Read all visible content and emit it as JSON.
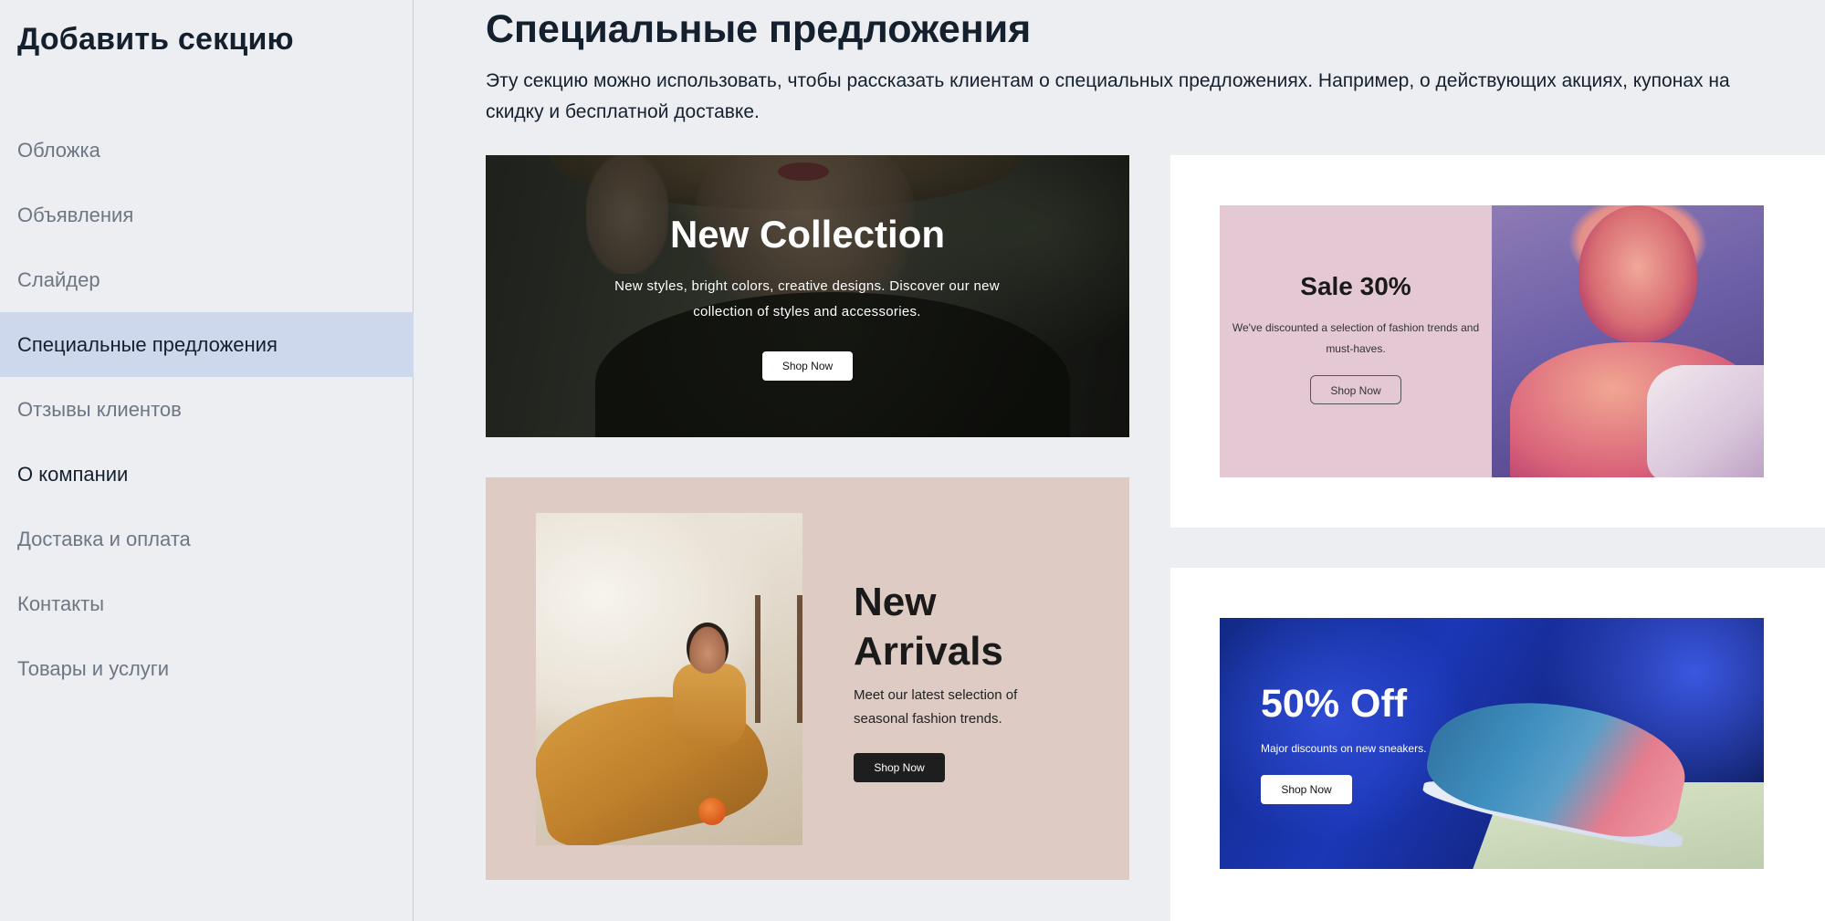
{
  "sidebar": {
    "title": "Добавить секцию",
    "items": [
      {
        "label": "Обложка"
      },
      {
        "label": "Объявления"
      },
      {
        "label": "Слайдер"
      },
      {
        "label": "Специальные предложения"
      },
      {
        "label": "Отзывы клиентов"
      },
      {
        "label": "О компании"
      },
      {
        "label": "Доставка и оплата"
      },
      {
        "label": "Контакты"
      },
      {
        "label": "Товары и услуги"
      }
    ],
    "active_index": 3
  },
  "main": {
    "title": "Специальные предложения",
    "description": "Эту секцию можно использовать, чтобы рассказать клиентам о специальных предложениях. Например, о действующих акциях, купонах на скидку и бесплатной доставке.",
    "cards": [
      {
        "headline": "New Collection",
        "text": "New styles, bright colors, creative designs. Discover our new collection of styles and accessories.",
        "button": "Shop Now"
      },
      {
        "headline": "Sale 30%",
        "text": "We've discounted a selection of fashion trends and must-haves.",
        "button": "Shop Now"
      },
      {
        "headline": "New Arrivals",
        "text": "Meet our latest selection of seasonal fashion trends.",
        "button": "Shop Now"
      },
      {
        "headline": "50% Off",
        "text": "Major discounts on new sneakers.",
        "button": "Shop Now"
      }
    ]
  },
  "colors": {
    "background": "#eceef1",
    "active_item": "#cdd8ec",
    "text_dark": "#15202e",
    "text_muted": "#6d7784",
    "card3_background": "#ddcbc4",
    "sale_panel": "#e4c9d4"
  }
}
